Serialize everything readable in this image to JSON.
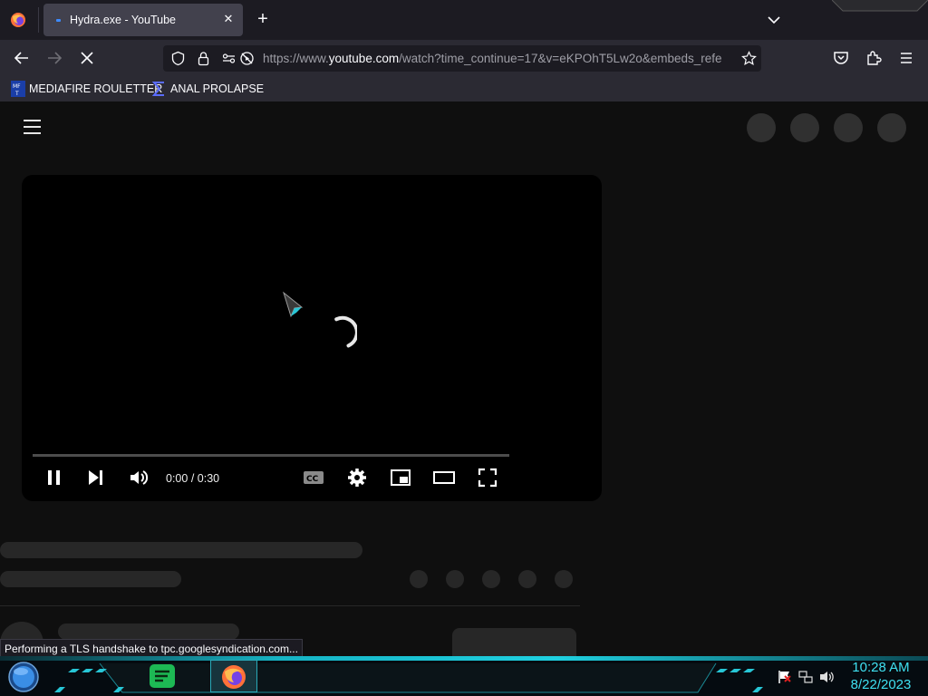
{
  "browser": {
    "tab": {
      "title": "Hydra.exe - YouTube"
    },
    "url": {
      "prefix": "https://www.",
      "domain": "youtube.com",
      "path": "/watch?time_continue=17&v=eKPOhT5Lw2o&embeds_refe"
    },
    "bookmarks": [
      {
        "label": "MEDIAFIRE ROULETTER",
        "icon": "mediafire-icon"
      },
      {
        "label": "ANAL PROLAPSE",
        "icon": "sigma-icon"
      }
    ],
    "status_text": "Performing a TLS handshake to tpc.googlesyndication.com..."
  },
  "player": {
    "time_current": "0:00",
    "time_sep": " / ",
    "time_total": "0:30",
    "progress": 0.0,
    "state": "loading"
  },
  "taskbar": {
    "time": "10:28 AM",
    "date": "8/22/2023",
    "apps": [
      "start-orb-icon",
      "notes-app-icon",
      "firefox-icon"
    ]
  },
  "colors": {
    "browser_chrome": "#2b2a33",
    "tab_active": "#42414d",
    "page_bg": "#0f0f0f",
    "skeleton": "#272727",
    "clock_accent": "#3fe0f0"
  }
}
